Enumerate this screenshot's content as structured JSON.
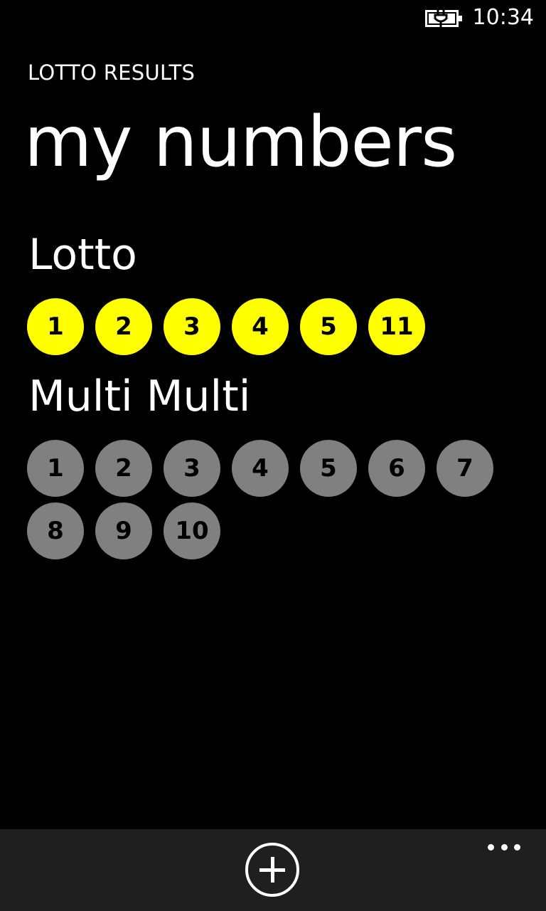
{
  "status_bar": {
    "time": "10:34",
    "battery_icon": "battery-charging-icon"
  },
  "header": {
    "app_title": "LOTTO RESULTS",
    "page_title": "my numbers"
  },
  "sections": [
    {
      "name": "Lotto",
      "ball_color": "#FFFF00",
      "numbers": [
        "1",
        "2",
        "3",
        "4",
        "5",
        "11"
      ]
    },
    {
      "name": "Multi Multi",
      "ball_color": "#808080",
      "numbers": [
        "1",
        "2",
        "3",
        "4",
        "5",
        "6",
        "7",
        "8",
        "9",
        "10"
      ]
    }
  ],
  "app_bar": {
    "add_icon": "add-circle-icon",
    "more_icon": "ellipsis-icon",
    "background": "#1f1f1f"
  }
}
